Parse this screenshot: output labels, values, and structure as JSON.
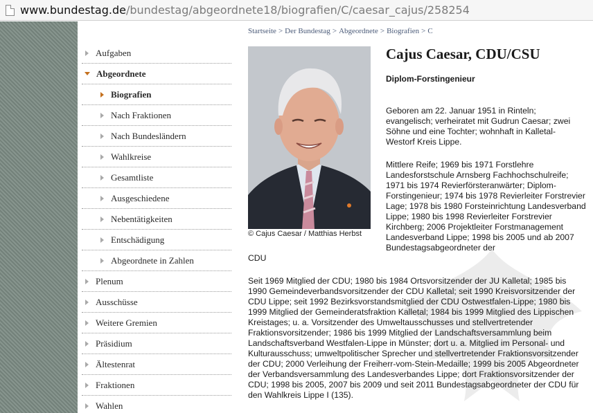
{
  "browser": {
    "url_host": "www.bundestag.de",
    "url_path": "/bundestag/abgeordnete18/biografien/C/caesar_cajus/258254"
  },
  "sidebar": {
    "items": [
      {
        "label": "Aufgaben"
      },
      {
        "label": "Abgeordnete"
      },
      {
        "label": "Biografien"
      },
      {
        "label": "Nach Fraktionen"
      },
      {
        "label": "Nach Bundesländern"
      },
      {
        "label": "Wahlkreise"
      },
      {
        "label": "Gesamtliste"
      },
      {
        "label": "Ausgeschiedene"
      },
      {
        "label": "Nebentätigkeiten"
      },
      {
        "label": "Entschädigung"
      },
      {
        "label": "Abgeordnete in Zahlen"
      },
      {
        "label": "Plenum"
      },
      {
        "label": "Ausschüsse"
      },
      {
        "label": "Weitere Gremien"
      },
      {
        "label": "Präsidium"
      },
      {
        "label": "Ältestenrat"
      },
      {
        "label": "Fraktionen"
      },
      {
        "label": "Wahlen"
      }
    ]
  },
  "breadcrumb": [
    "Startseite",
    "Der Bundestag",
    "Abgeordnete",
    "Biografien",
    "C"
  ],
  "profile": {
    "name": "Cajus Caesar, CDU/CSU",
    "profession": "Diplom-Forstingenieur",
    "photo_caption": "© Cajus Caesar / Matthias Herbst",
    "bio_personal": "Geboren am 22. Januar 1951 in Rinteln; evangelisch; verheiratet mit Gudrun Caesar; zwei Söhne und eine Tochter; wohnhaft in Kalletal-Westorf Kreis Lippe.",
    "bio_career": "Mittlere Reife; 1969 bis 1971 Forstlehre Landesforstschule Arnsberg Fachhochschulreife; 1971 bis 1974 Revierförsteranwärter; Diplom-Forstingenieur; 1974 bis 1978 Revierleiter Forstrevier Lage; 1978 bis 1980 Forsteinrichtung Landesverband Lippe; 1980 bis 1998 Revierleiter Forstrevier Kirchberg; 2006 Projektleiter Forstmanagement Landesverband Lippe; 1998 bis 2005 und ab 2007 Bundestagsabgeordneter der",
    "bio_career_cont": "CDU",
    "bio_politics": "Seit 1969 Mitglied der CDU; 1980 bis 1984 Ortsvorsitzender der JU Kalletal; 1985 bis 1990 Gemeindeverbandsvorsitzender der CDU Kalletal; seit 1990 Kreisvorsitzender der CDU Lippe; seit 1992 Bezirksvorstandsmitglied der CDU Ostwestfalen-Lippe; 1980 bis 1999 Mitglied der Gemeinderatsfraktion Kalletal; 1984 bis 1999 Mitglied des Lippischen Kreistages; u. a. Vorsitzender des Umweltausschusses und stellvertretender Fraktionsvorsitzender; 1986 bis 1999 Mitglied der Landschaftsversammlung beim Landschaftsverband Westfalen-Lippe in Münster; dort u. a. Mitglied im Personal- und Kulturausschuss; umweltpolitischer Sprecher und stellvertretender Fraktionsvorsitzender der CDU; 2000 Verleihung der Freiherr-vom-Stein-Medaille; 1999 bis 2005 Abgeordneter der Verbandsversammlung des Landesverbandes Lippe; dort Fraktionsvorsitzender der CDU; 1998 bis 2005, 2007 bis 2009 und seit 2011 Bundestagsabgeordneter der CDU für den Wahlkreis Lippe I (135)."
  },
  "colors": {
    "accent": "#c4701e",
    "strip": "#7d8c84",
    "link": "#4a5a78"
  }
}
